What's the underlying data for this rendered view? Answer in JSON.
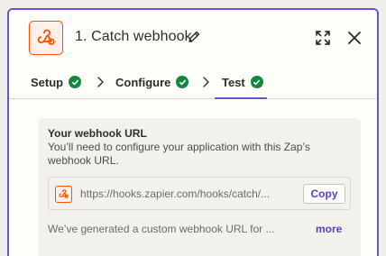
{
  "header": {
    "title": "1. Catch webhook",
    "icons": [
      "webhook-icon",
      "pencil-icon",
      "expand-icon",
      "close-icon"
    ]
  },
  "tabs": [
    {
      "label": "Setup",
      "complete": true
    },
    {
      "label": "Configure",
      "complete": true
    },
    {
      "label": "Test",
      "complete": true,
      "active": true
    }
  ],
  "webhook": {
    "title": "Your webhook URL",
    "description": "You’ll need to configure your application with this Zap’s webhook URL.",
    "url": "https://hooks.zapier.com/hooks/catch/...",
    "copy_label": "Copy",
    "generated_text": "We’ve generated a custom webhook URL for ...",
    "more_label": "more"
  },
  "colors": {
    "accent": "#6d4fd6",
    "brand": "#ff4f00",
    "success": "#12883f"
  }
}
